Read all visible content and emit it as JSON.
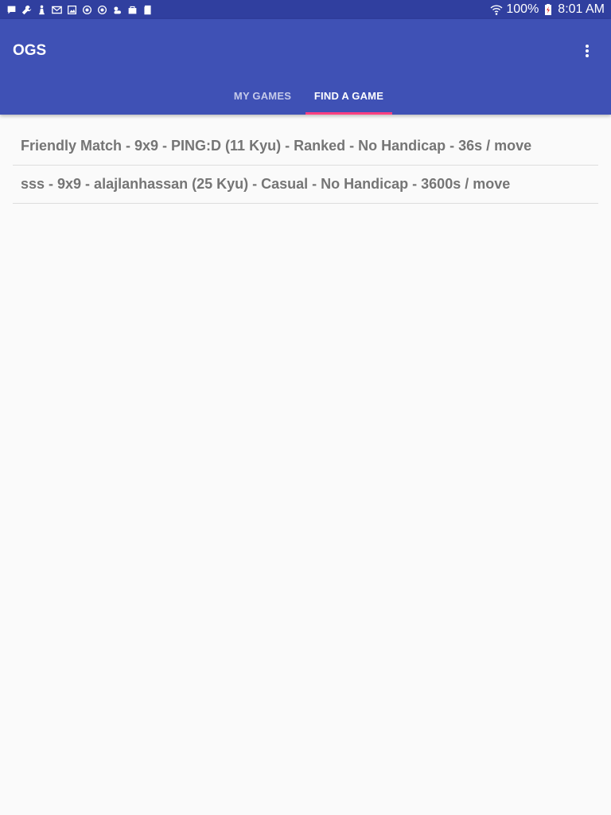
{
  "status_bar": {
    "left_icons": [
      "chat-icon",
      "wrench-icon",
      "chess-piece-icon",
      "mail-icon",
      "image-icon",
      "sync-icon",
      "sync-icon",
      "weather-icon",
      "store-icon",
      "sd-card-icon"
    ],
    "battery": "100%",
    "time": "8:01 AM"
  },
  "app_bar": {
    "title": "OGS",
    "color": "#3f51b5"
  },
  "tabs": [
    {
      "label": "MY GAMES",
      "selected": false
    },
    {
      "label": "FIND A GAME",
      "selected": true
    }
  ],
  "games": [
    {
      "text": "Friendly Match - 9x9 - PING:D (11 Kyu) - Ranked - No Handicap - 36s / move"
    },
    {
      "text": "sss - 9x9 - alajlanhassan (25 Kyu) - Casual - No Handicap - 3600s / move"
    }
  ]
}
